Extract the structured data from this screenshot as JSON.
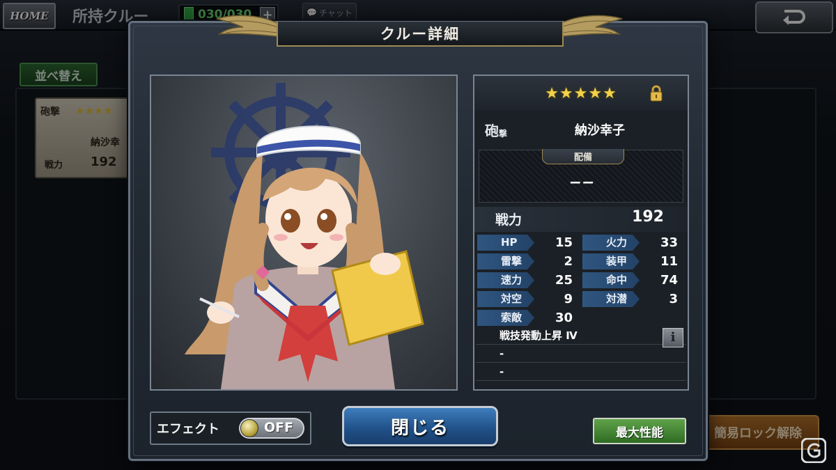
{
  "background": {
    "home_label": "HOME",
    "title": "所持クルー",
    "crew_count": "030/030",
    "chat_label": "チャット",
    "sort_label": "並べ替え",
    "card": {
      "class": "砲撃",
      "stars": "★★★★",
      "name": "納沙幸",
      "power_label": "戦力",
      "power_value": "192"
    },
    "unlock_label": "簡易ロック解除"
  },
  "modal": {
    "title": "クルー詳細",
    "rarity_stars": "★★★★★",
    "class_big": "砲",
    "class_small": "撃",
    "name": "納沙幸子",
    "equip_label": "配備",
    "equip_value": "−−",
    "power_label": "戦力",
    "power_value": "192",
    "stats": [
      {
        "label": "HP",
        "value": "15",
        "label2": "火力",
        "value2": "33"
      },
      {
        "label": "雷撃",
        "value": "2",
        "label2": "装甲",
        "value2": "11"
      },
      {
        "label": "速力",
        "value": "25",
        "label2": "命中",
        "value2": "74"
      },
      {
        "label": "対空",
        "value": "9",
        "label2": "対潜",
        "value2": "3"
      },
      {
        "label": "索敵",
        "value": "30"
      }
    ],
    "skills": [
      "戦技発動上昇 Ⅳ",
      "-",
      "-"
    ],
    "info_label": "i",
    "effect_label": "エフェクト",
    "effect_state": "OFF",
    "close_label": "閉じる",
    "max_label": "最大性能"
  },
  "colors": {
    "accent_gold": "#a08a55",
    "stat_label_blue": "#2f5680",
    "close_blue": "#1f4f86",
    "max_green": "#2f6b22"
  }
}
